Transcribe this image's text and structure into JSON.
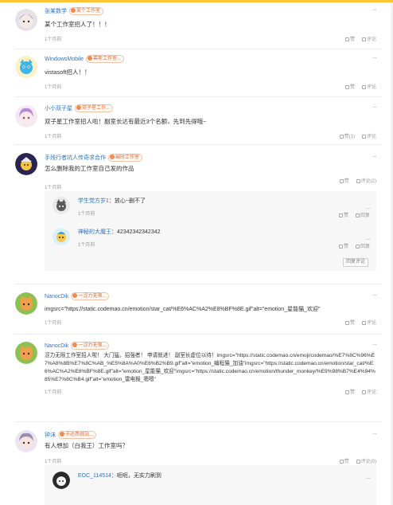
{
  "icons": {
    "like": "thumbs-up-icon",
    "comment": "comment-icon",
    "more": "more-dots-icon"
  },
  "colors": {
    "username": "#2f74c6",
    "badge_text": "#e46b33",
    "accent": "#fec433"
  },
  "comments": [
    {
      "user": "张某数学",
      "badge": "某个工作室",
      "text": "某个工作室招人了！！！",
      "time": "1个月前",
      "more": "···",
      "like": "赞",
      "reply": "评论"
    },
    {
      "user": "WindowsMobile",
      "badge": "幕斯工作室...",
      "text": "vistasoft招人！！",
      "time": "1个月前",
      "more": "···",
      "like": "赞",
      "reply": "评论"
    },
    {
      "user": "小小双子星",
      "badge": "双子星工作...",
      "text": "双子星工作室招人啦！副室长达有最近3个名额，先到先得哦~",
      "time": "1个月前",
      "more": "···",
      "like": "赞(1)",
      "reply": "评论"
    },
    {
      "user": "手残行者坑人传奇求合作",
      "badge": "幽时工作室",
      "text": "怎么删除我的工作室自己发的作品",
      "time": "1个月前",
      "more": "···",
      "like": "赞",
      "reply": "评论(2)",
      "replies": [
        {
          "user": "学生党方岁1",
          "text": "：放心~删不了",
          "time": "1个月前",
          "more": "···",
          "like": "赞",
          "reply": "回复"
        },
        {
          "user": "神秘的大魔王",
          "text": "：42342342342342",
          "time": "1个月前",
          "more": "···",
          "like": "赞",
          "reply": "回复"
        }
      ],
      "reply_button": "回复评论"
    },
    {
      "user": "NanocDik",
      "badge": "一涩力无限...",
      "text": "imgsrc=\"https://static.codemao.cn/emotion/star_cat/%E6%AC%A2%E8%BF%8E.gif\"alt=\"emotion_星能猫_欢迎\"",
      "time": "1个月前",
      "more": "···",
      "like": "赞",
      "reply": "评论"
    },
    {
      "user": "NanocDik",
      "badge": "一涩力无限...",
      "text": "涩力无限工作室招人啦！ 大门猛，招强者！ 申请就进！ 副室长虚位以待！imgsrc=\"https://static.codemao.cn/emoji/codemao/%E7%8C%96%E7%A8%8B%E7%8C%AB_%E5%8A%A0%E6%B2%B9.gif\"alt=\"emotion_编程猫_加油\"imgsrc=\"https://static.codemao.cn/emotion/star_cat/%E6%AC%A2%E8%BF%8E.gif\"alt=\"emotion_星能猫_欢迎\"imgsrc=\"https://static.codemao.cn/emotion/thunder_monkey/%E9%98%B7%E4%94%85%E7%8C%B4.gif\"alt=\"emotion_雷电猴_嗯嗯\"",
      "time": "1个月前",
      "more": "···",
      "like": "赞",
      "reply": "评论"
    },
    {
      "user": "钟沫",
      "badge": "卡达西挑站...",
      "text": "有人想加（白我王）工作室吗？",
      "time": "1个月前",
      "more": "···",
      "like": "赞",
      "reply": "评论(9)",
      "replies": [
        {
          "user": "EOC_114514",
          "text": "：呃呃，无实力刷到",
          "time": "",
          "more": "···",
          "like": "",
          "reply": ""
        }
      ]
    }
  ]
}
